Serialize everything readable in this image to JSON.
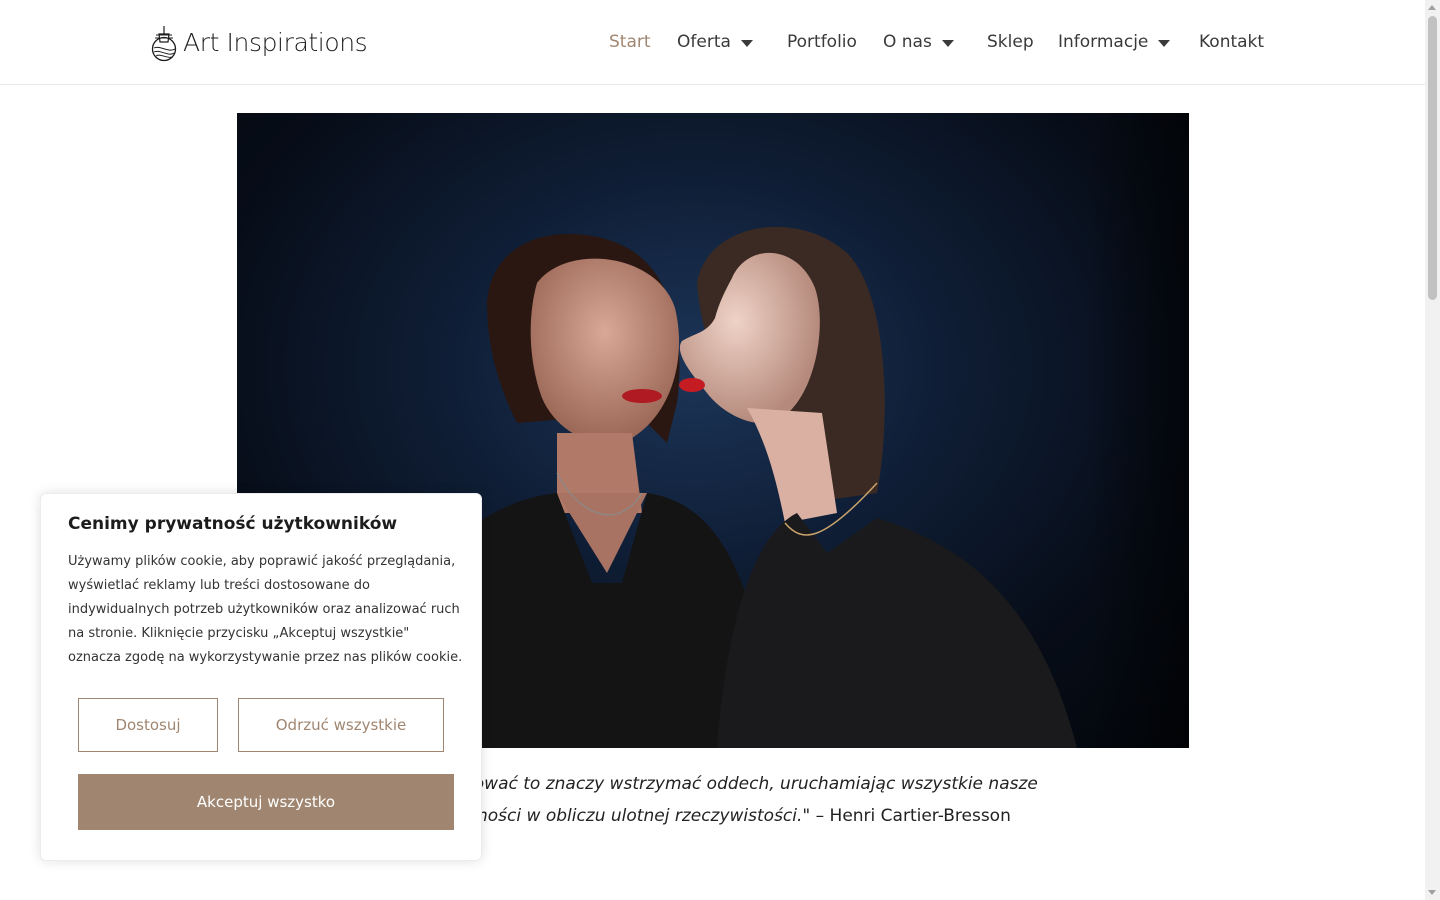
{
  "header": {
    "logo_text": "Art Inspirations",
    "nav": [
      {
        "label": "Start",
        "active": true,
        "dropdown": false
      },
      {
        "label": "Oferta",
        "active": false,
        "dropdown": true
      },
      {
        "label": "Portfolio",
        "active": false,
        "dropdown": false
      },
      {
        "label": "O nas",
        "active": false,
        "dropdown": true
      },
      {
        "label": "Sklep",
        "active": false,
        "dropdown": false
      },
      {
        "label": "Informacje",
        "active": false,
        "dropdown": true
      },
      {
        "label": "Kontakt",
        "active": false,
        "dropdown": false
      }
    ]
  },
  "quote": {
    "line1": "ufować to znaczy wstrzymać oddech, uruchamiając wszystkie nasze",
    "line2_italic": "ności w obliczu ulotnej rzeczywistości.\"",
    "author": " – Henri Cartier-Bresson"
  },
  "cookie_banner": {
    "title": "Cenimy prywatność użytkowników",
    "text": "Używamy plików cookie, aby poprawić jakość przeglądania, wyświetlać reklamy lub treści dostosowane do indywidualnych potrzeb użytkowników oraz analizować ruch na stronie. Kliknięcie przycisku „Akceptuj wszystkie\" oznacza zgodę na wykorzystywanie przez nas plików cookie.",
    "customize_label": "Dostosuj",
    "reject_label": "Odrzuć wszystkie",
    "accept_label": "Akceptuj wszystko"
  },
  "colors": {
    "accent": "#a08670",
    "nav_text": "#3a3a3a",
    "photo_bg": "#0f1e36"
  }
}
